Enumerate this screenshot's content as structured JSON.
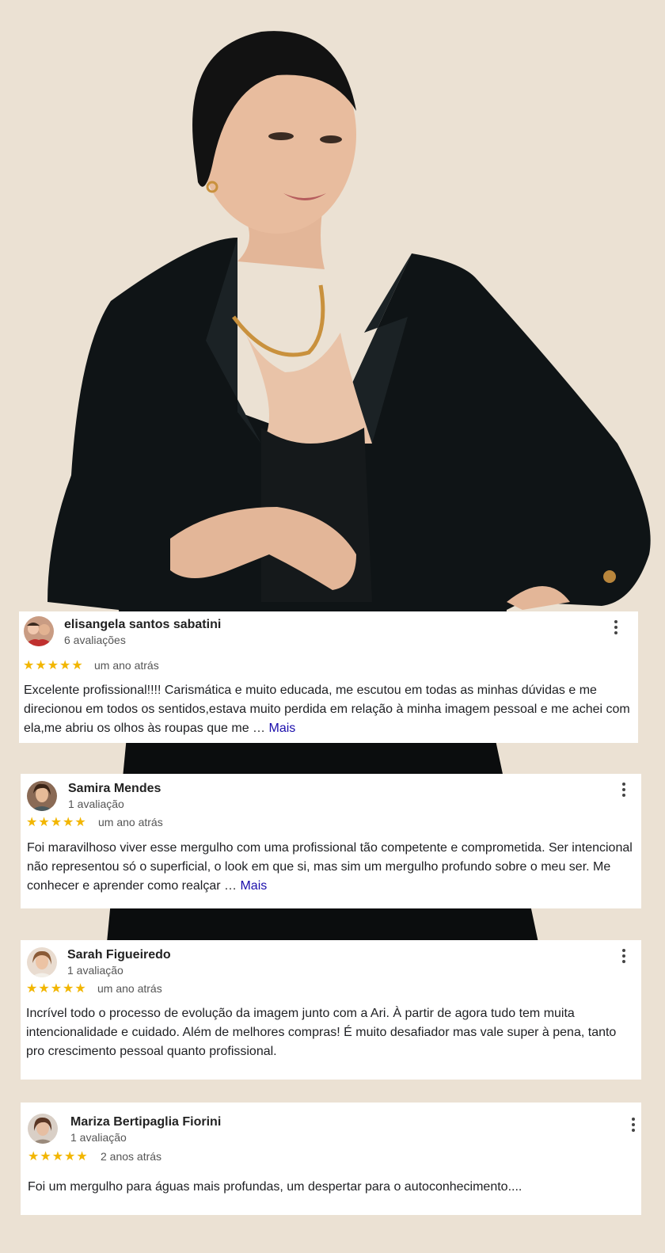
{
  "hero": {
    "description_icon": "portrait-photo"
  },
  "reviews": [
    {
      "name": "elisangela santos sabatini",
      "count": "6 avaliações",
      "stars": "★★★★★",
      "rating": 5,
      "when": "um ano atrás",
      "text": "Excelente profissional!!!! Carismática e muito educada, me escutou em todas as minhas dúvidas e me direcionou em todos os sentidos,estava muito perdida em relação à minha imagem pessoal e me achei com ela,me abriu os olhos às roupas que me … ",
      "more": "Mais"
    },
    {
      "name": "Samira Mendes",
      "count": "1 avaliação",
      "stars": "★★★★★",
      "rating": 5,
      "when": "um ano atrás",
      "text": "Foi maravilhoso viver esse mergulho com uma profissional tão competente e comprometida. Ser intencional não representou só o superficial, o look em que si, mas sim um mergulho profundo sobre o meu ser. Me conhecer e aprender como realçar … ",
      "more": "Mais"
    },
    {
      "name": "Sarah Figueiredo",
      "count": "1 avaliação",
      "stars": "★★★★★",
      "rating": 5,
      "when": "um ano atrás",
      "text": "Incrível todo o processo de evolução da imagem junto com a Ari. À partir de agora tudo tem muita intencionalidade e cuidado. Além de melhores compras! É muito desafiador mas vale super à pena, tanto pro crescimento pessoal quanto profissional."
    },
    {
      "name": "Mariza Bertipaglia Fiorini",
      "count": "1 avaliação",
      "stars": "★★★★★",
      "rating": 5,
      "when": "2 anos atrás",
      "text": "Foi um mergulho para águas mais profundas, um despertar para o autoconhecimento...."
    }
  ],
  "colors": {
    "background": "#ebe1d3",
    "star": "#f2b600",
    "link": "#1a0dab",
    "blazer": "#0f1416"
  }
}
